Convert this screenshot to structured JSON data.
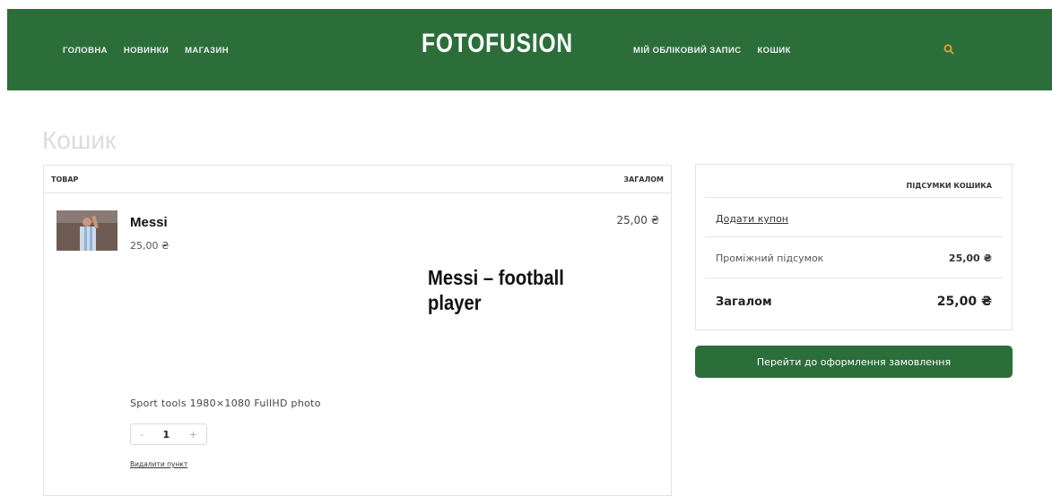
{
  "header": {
    "nav_left": [
      "ГОЛОВНА",
      "НОВИНКИ",
      "МАГАЗИН"
    ],
    "logo": "FOTOFUSION",
    "nav_right": [
      "МІЙ ОБЛІКОВИЙ ЗАПИС",
      "КОШИК"
    ],
    "search_icon": "search-icon",
    "colors": {
      "bar": "#2b6e3a",
      "accent": "#e0a52a"
    }
  },
  "page": {
    "title": "Кошик"
  },
  "cart": {
    "columns": {
      "product": "ТОВАР",
      "total": "ЗАГАЛОМ"
    },
    "items": [
      {
        "name": "Messi",
        "price": "25,00 ₴",
        "line_total": "25,00 ₴",
        "promo_text": "Messi – football player",
        "description": "Sport tools 1980×1080 FullHD photo",
        "quantity": "1",
        "qty_minus": "-",
        "qty_plus": "+",
        "remove_label": "Видалити пункт"
      }
    ]
  },
  "totals": {
    "heading": "ПІДСУМКИ КОШИКА",
    "coupon_label": "Додати купон",
    "subtotal_label": "Проміжний підсумок",
    "subtotal_value": "25,00 ₴",
    "total_label": "Загалом",
    "total_value": "25,00 ₴"
  },
  "checkout": {
    "label": "Перейти до оформлення замовлення"
  }
}
